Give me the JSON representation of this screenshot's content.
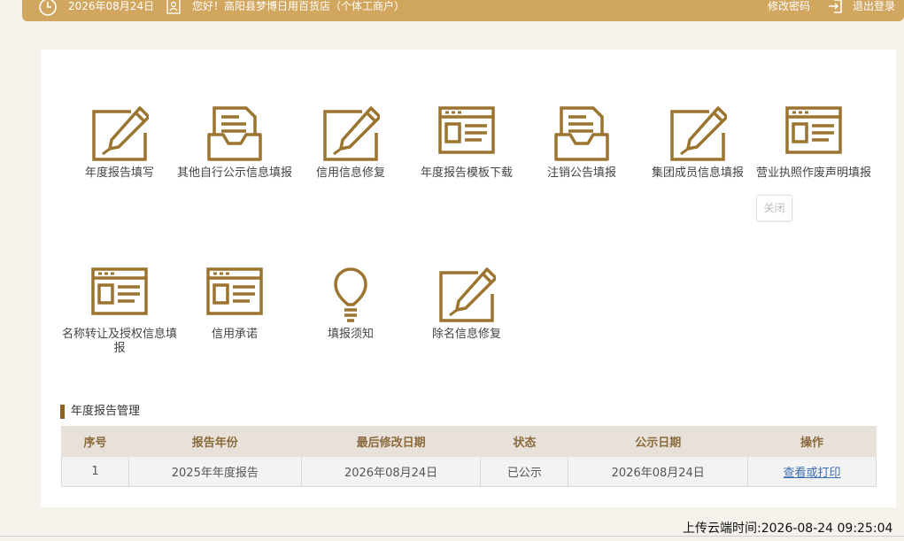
{
  "header": {
    "date": "2026年08月24日",
    "greeting": "您好！高阳县梦博日用百货店（个体工商户）",
    "change_password": "修改密码",
    "logout": "退出登录"
  },
  "tiles": [
    {
      "label": "年度报告填写",
      "icon": "edit-pen-icon"
    },
    {
      "label": "其他自行公示信息填报",
      "icon": "inbox-document-icon"
    },
    {
      "label": "信用信息修复",
      "icon": "edit-pen-icon"
    },
    {
      "label": "年度报告模板下载",
      "icon": "template-icon"
    },
    {
      "label": "注销公告填报",
      "icon": "inbox-document-icon"
    },
    {
      "label": "集团成员信息填报",
      "icon": "edit-pen-icon"
    },
    {
      "label": "营业执照作废声明填报",
      "icon": "template-icon"
    },
    {
      "label": "名称转让及授权信息填报",
      "icon": "template-icon"
    },
    {
      "label": "信用承诺",
      "icon": "template-icon"
    },
    {
      "label": "填报须知",
      "icon": "lightbulb-icon"
    },
    {
      "label": "除名信息修复",
      "icon": "edit-pen-icon"
    }
  ],
  "tooltip": "关闭",
  "section": {
    "title": "年度报告管理"
  },
  "table": {
    "headers": [
      "序号",
      "报告年份",
      "最后修改日期",
      "状态",
      "公示日期",
      "操作"
    ],
    "rows": [
      {
        "no": "1",
        "year": "2025年年度报告",
        "modified": "2026年08月24日",
        "status": "已公示",
        "published": "2026年08月24日",
        "action": "查看或打印"
      }
    ]
  },
  "footer": {
    "upload_time": "上传云端时间:2026-08-24 09:25:04"
  },
  "colors": {
    "accent": "#d1a65f",
    "icon": "#9b7430",
    "header_text": "#8b6b3d",
    "link": "#3a6fb1"
  }
}
